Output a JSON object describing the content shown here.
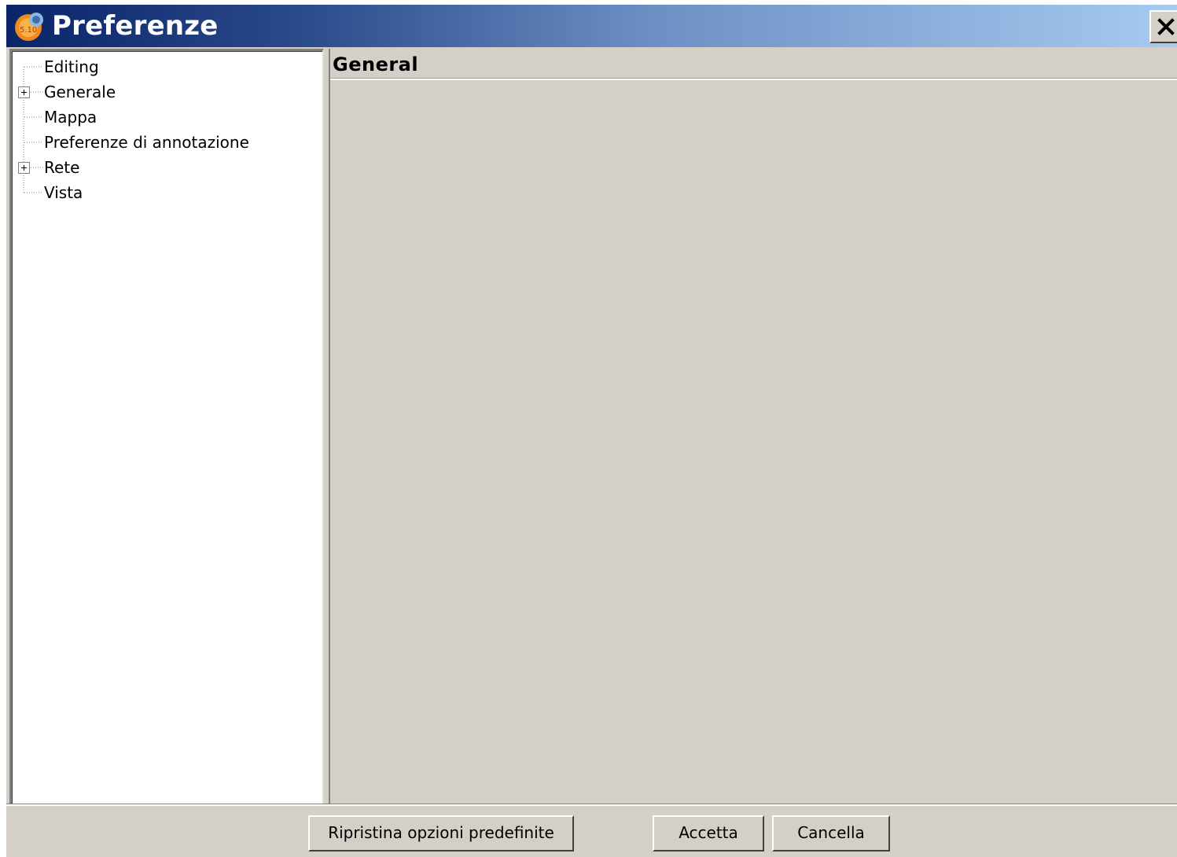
{
  "window": {
    "title": "Preferenze",
    "close_glyph": "×",
    "colors": {
      "titlebar_start": "#0a246a",
      "titlebar_end": "#a6caf0",
      "face": "#d4d0c8"
    }
  },
  "tree": {
    "items": [
      {
        "label": "Editing",
        "expandable": false
      },
      {
        "label": "Generale",
        "expandable": true
      },
      {
        "label": "Mappa",
        "expandable": false
      },
      {
        "label": "Preferenze di annotazione",
        "expandable": false
      },
      {
        "label": "Rete",
        "expandable": true
      },
      {
        "label": "Vista",
        "expandable": false
      }
    ]
  },
  "content": {
    "title": "General"
  },
  "buttons": {
    "restore_defaults": "Ripristina opzioni predefinite",
    "accept": "Accetta",
    "cancel": "Cancella"
  }
}
